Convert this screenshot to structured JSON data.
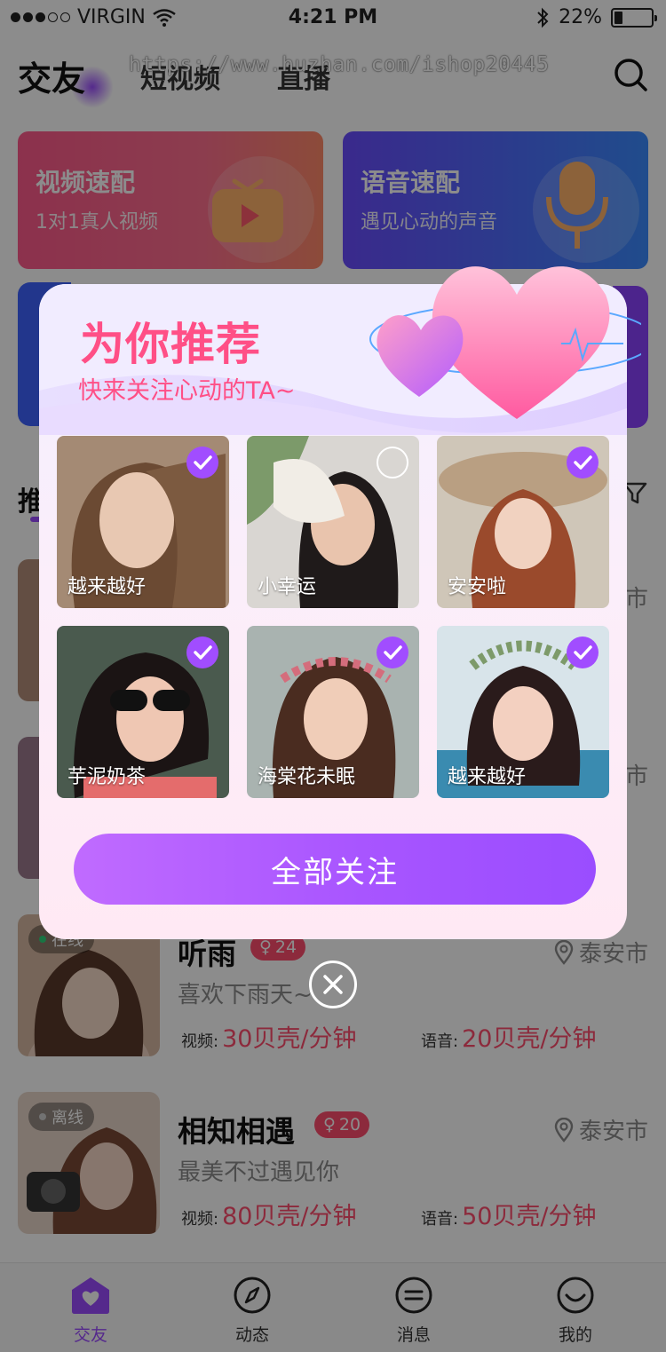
{
  "status_bar": {
    "carrier": "VIRGIN",
    "time": "4:21 PM",
    "battery": "22%",
    "battery_level": 0.22
  },
  "watermark": "https://www.huzhan.com/ishop20445",
  "header": {
    "tabs": [
      "交友",
      "短视频",
      "直播"
    ],
    "active_tab": 0
  },
  "promo_cards": [
    {
      "title": "视频速配",
      "subtitle": "1对1真人视频"
    },
    {
      "title": "语音速配",
      "subtitle": "遇见心动的声音"
    }
  ],
  "section": {
    "label": "推"
  },
  "list": [
    {
      "status": "在线",
      "name": "听雨",
      "age": "24",
      "city": "泰安市",
      "motto": "喜欢下雨天~",
      "video_label": "视频:",
      "video_price": "30贝壳/分钟",
      "voice_label": "语音:",
      "voice_price": "20贝壳/分钟"
    },
    {
      "status": "离线",
      "name": "相知相遇",
      "age": "20",
      "city": "泰安市",
      "motto": "最美不过遇见你",
      "video_label": "视频:",
      "video_price": "80贝壳/分钟",
      "voice_label": "语音:",
      "voice_price": "50贝壳/分钟"
    }
  ],
  "partial_rows": {
    "city_1": "市",
    "city_2": "市"
  },
  "tabbar": {
    "items": [
      "交友",
      "动态",
      "消息",
      "我的"
    ],
    "active": 0
  },
  "modal": {
    "title": "为你推荐",
    "subtitle": "快来关注心动的TA~",
    "users": [
      {
        "name": "越来越好",
        "selected": true
      },
      {
        "name": "小幸运",
        "selected": false
      },
      {
        "name": "安安啦",
        "selected": true
      },
      {
        "name": "芋泥奶茶",
        "selected": true
      },
      {
        "name": "海棠花未眠",
        "selected": true
      },
      {
        "name": "越来越好",
        "selected": true
      }
    ],
    "follow_all": "全部关注"
  },
  "colors": {
    "accent": "#9b4cff",
    "pink": "#ff4f86",
    "price": "#ff4d6d"
  }
}
